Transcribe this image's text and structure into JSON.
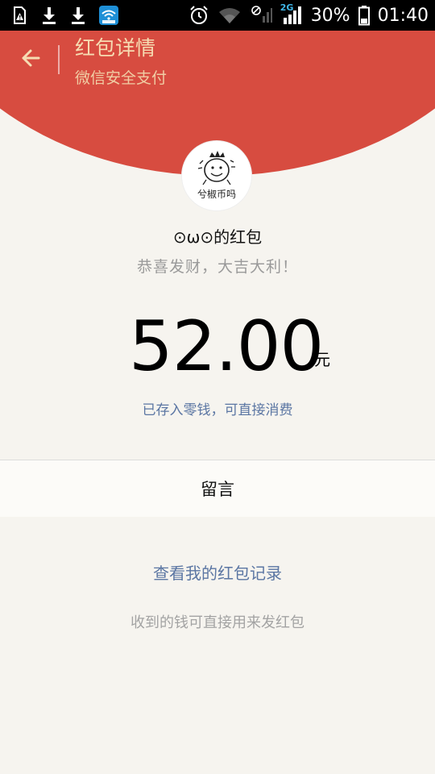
{
  "status_bar": {
    "battery_percent": "30%",
    "time": "01:40",
    "network_type": "2G",
    "icons": [
      "sim-alert-icon",
      "download-icon",
      "download-icon",
      "wifi-app-icon",
      "alarm-icon",
      "wifi-icon",
      "no-signal-icon",
      "cell-signal-icon",
      "battery-icon"
    ]
  },
  "header": {
    "title": "红包详情",
    "subtitle": "微信安全支付",
    "back_icon": "back-arrow-icon"
  },
  "packet": {
    "avatar_icon": "cartoon-avatar-icon",
    "avatar_caption": "兮椒币吗",
    "sender_name": "⊙ω⊙的红包",
    "greeting": "恭喜发财，大吉大利！",
    "amount": "52.00",
    "currency": "元",
    "deposit_note": "已存入零钱，可直接消费"
  },
  "message": {
    "label": "留言"
  },
  "footer": {
    "records_link": "查看我的红包记录",
    "note": "收到的钱可直接用来发红包"
  },
  "colors": {
    "header_red": "#d74c40",
    "header_text": "#f6dcb2",
    "link_blue": "#5b76a3",
    "page_bg": "#f6f4ef"
  }
}
